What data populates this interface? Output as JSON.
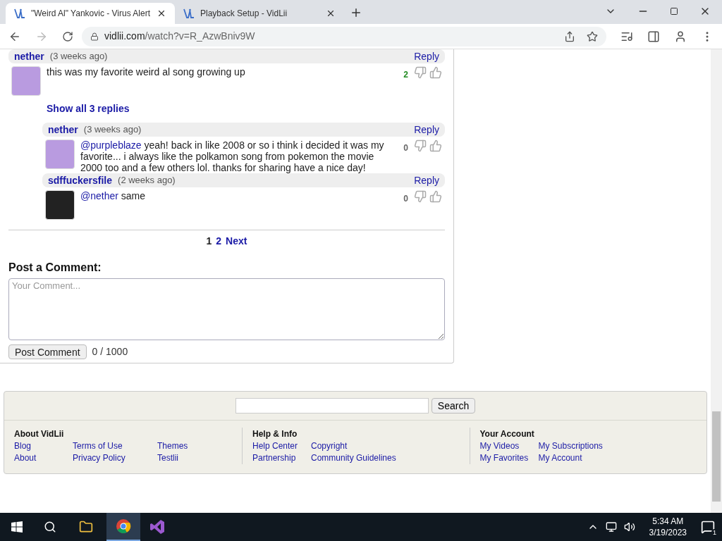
{
  "browser": {
    "tabs": [
      {
        "title": "\"Weird Al\" Yankovic - Virus Alert",
        "selected": true
      },
      {
        "title": "Playback Setup - VidLii",
        "selected": false
      }
    ],
    "url_host": "vidlii.com",
    "url_path": "/watch?v=R_AzwBniv9W"
  },
  "comments": [
    {
      "author": "nether",
      "time": "(3 weeks ago)",
      "reply": "Reply",
      "avatar": {
        "color": "#b99be0"
      },
      "text": "this was my favorite weird al song growing up",
      "score": {
        "text": "2",
        "color": "#228b22"
      },
      "show_replies": "Show all 3 replies",
      "replies": [
        {
          "author": "nether",
          "time": "(3 weeks ago)",
          "reply": "Reply",
          "avatar": {
            "color": "#b99be0"
          },
          "mention": "@purpleblaze",
          "text": " yeah! back in like 2008 or so i think i decided it was my favorite... i always like the polkamon song from pokemon the movie 2000 too and a few others lol. thanks for sharing have a nice day!",
          "score": {
            "text": "0",
            "color": "#666666"
          }
        },
        {
          "author": "sdffuckersfile",
          "time": "(2 weeks ago)",
          "reply": "Reply",
          "avatar": {
            "color": "#222222"
          },
          "mention": "@nether",
          "text": " same",
          "score": {
            "text": "0",
            "color": "#666666"
          }
        }
      ]
    }
  ],
  "pagination": [
    {
      "label": "1",
      "selected": true
    },
    {
      "label": "2",
      "selected": false
    },
    {
      "label": "Next",
      "selected": false
    }
  ],
  "post": {
    "title": "Post a Comment:",
    "placeholder": "Your Comment...",
    "button": "Post Comment",
    "counter": "0 / 1000"
  },
  "footer": {
    "search_button": "Search",
    "sections": [
      {
        "title": "About VidLii",
        "columns": [
          [
            "Blog",
            "About"
          ],
          [
            "Terms of Use",
            "Privacy Policy"
          ],
          [
            "Themes",
            "Testlii"
          ]
        ]
      },
      {
        "title": "Help & Info",
        "columns": [
          [
            "Help Center",
            "Partnership"
          ],
          [
            "Copyright",
            "Community Guidelines"
          ]
        ]
      },
      {
        "title": "Your Account",
        "columns": [
          [
            "My Videos",
            "My Favorites"
          ],
          [
            "My Subscriptions",
            "My Account"
          ]
        ]
      }
    ]
  },
  "taskbar": {
    "time": "5:34 AM",
    "date": "3/19/2023",
    "notifications": "1"
  }
}
